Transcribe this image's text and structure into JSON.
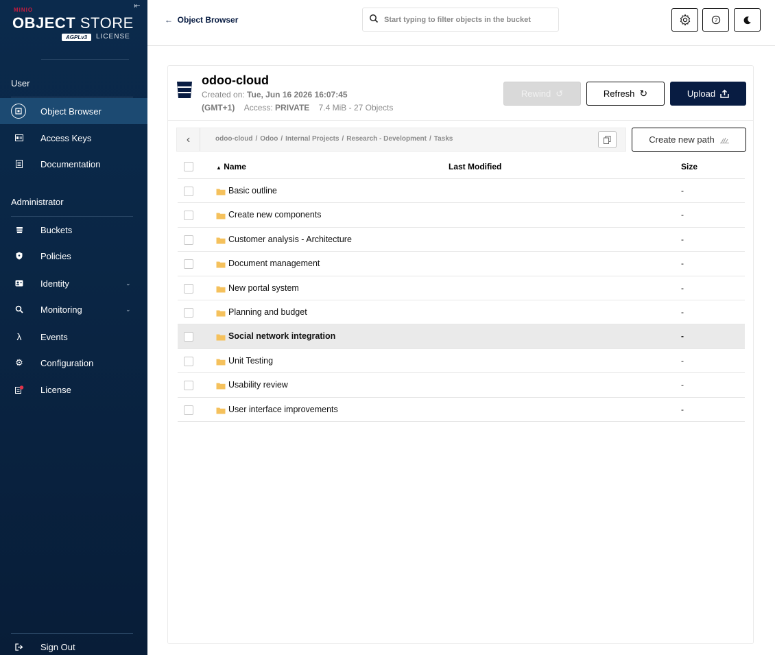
{
  "sidebar": {
    "logo": {
      "minio": "MINIO",
      "title_bold": "OBJECT",
      "title_light": " STORE",
      "badge": "AGPLv3",
      "license": "LICENSE"
    },
    "sections": {
      "user": "User",
      "administrator": "Administrator"
    },
    "items": [
      {
        "label": "Object Browser",
        "icon": "object-browser-icon"
      },
      {
        "label": "Access Keys",
        "icon": "access-keys-icon"
      },
      {
        "label": "Documentation",
        "icon": "documentation-icon"
      },
      {
        "label": "Buckets",
        "icon": "buckets-icon"
      },
      {
        "label": "Policies",
        "icon": "policies-icon"
      },
      {
        "label": "Identity",
        "icon": "identity-icon"
      },
      {
        "label": "Monitoring",
        "icon": "monitoring-icon"
      },
      {
        "label": "Events",
        "icon": "lambda-icon"
      },
      {
        "label": "Configuration",
        "icon": "gear-icon"
      },
      {
        "label": "License",
        "icon": "license-icon"
      }
    ],
    "sign_out": "Sign Out",
    "colors": {
      "background": "#0b2a4c",
      "active": "#1c4a72",
      "alert_dot": "#e0344b"
    }
  },
  "topbar": {
    "back_label": "Object Browser",
    "search_placeholder": "Start typing to filter objects in the bucket"
  },
  "bucket": {
    "name": "odoo-cloud",
    "created_label": "Created on: ",
    "created_value": "Tue, Jun 16 2026 16:07:45",
    "timezone": "(GMT+1)",
    "access_label": "Access: ",
    "access_value": "PRIVATE",
    "usage": "7.4 MiB - 27 Objects",
    "buttons": {
      "rewind": "Rewind",
      "refresh": "Refresh",
      "upload": "Upload"
    }
  },
  "breadcrumb": {
    "parts": [
      "odoo-cloud",
      "Odoo",
      "Internal Projects",
      "Research - Development",
      "Tasks"
    ],
    "separator": "/"
  },
  "create_path_label": "Create new path",
  "table": {
    "columns": {
      "name": "Name",
      "modified": "Last Modified",
      "size": "Size"
    },
    "rows": [
      {
        "name": "Basic outline",
        "modified": "",
        "size": "-"
      },
      {
        "name": "Create new components",
        "modified": "",
        "size": "-"
      },
      {
        "name": "Customer analysis - Architecture",
        "modified": "",
        "size": "-"
      },
      {
        "name": "Document management",
        "modified": "",
        "size": "-"
      },
      {
        "name": "New portal system",
        "modified": "",
        "size": "-"
      },
      {
        "name": "Planning and budget",
        "modified": "",
        "size": "-"
      },
      {
        "name": "Social network integration",
        "modified": "",
        "size": "-"
      },
      {
        "name": "Unit Testing",
        "modified": "",
        "size": "-"
      },
      {
        "name": "Usability review",
        "modified": "",
        "size": "-"
      },
      {
        "name": "User interface improvements",
        "modified": "",
        "size": "-"
      }
    ],
    "highlighted_row": 6
  },
  "colors": {
    "primary": "#081c42",
    "folder": "#f5c15c",
    "disabled": "#d9d9d9"
  }
}
